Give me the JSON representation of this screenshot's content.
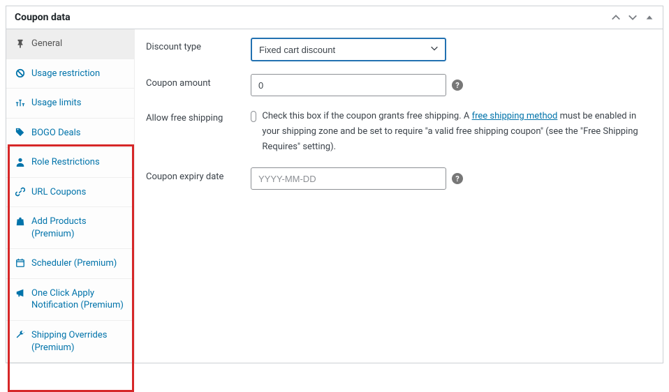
{
  "panel": {
    "title": "Coupon data"
  },
  "sidebar": {
    "tabs": [
      {
        "label": "General"
      },
      {
        "label": "Usage restriction"
      },
      {
        "label": "Usage limits"
      },
      {
        "label": "BOGO Deals"
      },
      {
        "label": "Role Restrictions"
      },
      {
        "label": "URL Coupons"
      },
      {
        "label": "Add Products (Premium)"
      },
      {
        "label": "Scheduler (Premium)"
      },
      {
        "label": "One Click Apply Notification (Premium)"
      },
      {
        "label": "Shipping Overrides (Premium)"
      }
    ]
  },
  "fields": {
    "discount_type": {
      "label": "Discount type",
      "value": "Fixed cart discount"
    },
    "coupon_amount": {
      "label": "Coupon amount",
      "value": "0"
    },
    "free_shipping": {
      "label": "Allow free shipping",
      "text_before": "Check this box if the coupon grants free shipping. A ",
      "link_text": "free shipping method",
      "text_after": " must be enabled in your shipping zone and be set to require \"a valid free shipping coupon\" (see the \"Free Shipping Requires\" setting)."
    },
    "expiry": {
      "label": "Coupon expiry date",
      "placeholder": "YYYY-MM-DD"
    }
  }
}
